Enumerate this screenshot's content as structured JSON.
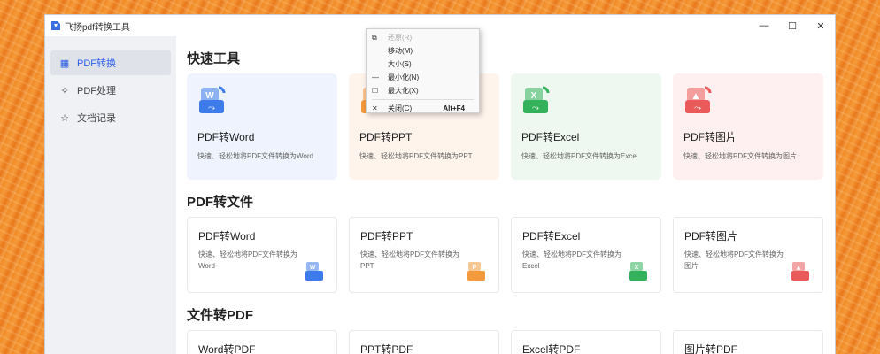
{
  "window": {
    "title": "飞扬pdf转换工具"
  },
  "titlebar": {
    "min_glyph": "—",
    "max_glyph": "☐",
    "close_glyph": "✕"
  },
  "sidebar": {
    "items": [
      {
        "label": "PDF转换",
        "icon": "grid-icon",
        "glyph": "▦",
        "active": true
      },
      {
        "label": "PDF处理",
        "icon": "magic-wand-icon",
        "glyph": "✧",
        "active": false
      },
      {
        "label": "文档记录",
        "icon": "star-icon",
        "glyph": "☆",
        "active": false
      }
    ]
  },
  "quick": {
    "title": "快速工具",
    "cards": [
      {
        "title": "PDF转Word",
        "desc": "快速、轻松地将PDF文件转换为Word",
        "letter": "W",
        "color": "#3d7bea"
      },
      {
        "title": "PDF转PPT",
        "desc": "快速、轻松地将PDF文件转换为PPT",
        "letter": "P",
        "color": "#f29a3c"
      },
      {
        "title": "PDF转Excel",
        "desc": "快速、轻松地将PDF文件转换为Excel",
        "letter": "X",
        "color": "#33b15b"
      },
      {
        "title": "PDF转图片",
        "desc": "快速、轻松地将PDF文件转换为图片",
        "letter": "▲",
        "color": "#ea5a5a"
      }
    ]
  },
  "pdf_to": {
    "title": "PDF转文件",
    "cards": [
      {
        "title": "PDF转Word",
        "desc": "快速、轻松地将PDF文件转换为Word",
        "letter": "W",
        "color": "#3d7bea"
      },
      {
        "title": "PDF转PPT",
        "desc": "快速、轻松地将PDF文件转换为PPT",
        "letter": "P",
        "color": "#f29a3c"
      },
      {
        "title": "PDF转Excel",
        "desc": "快速、轻松地将PDF文件转换为Excel",
        "letter": "X",
        "color": "#33b15b"
      },
      {
        "title": "PDF转图片",
        "desc": "快速、轻松地将PDF文件转换为图片",
        "letter": "▲",
        "color": "#ea5a5a"
      }
    ]
  },
  "to_pdf": {
    "title": "文件转PDF",
    "cards": [
      {
        "title": "Word转PDF"
      },
      {
        "title": "PPT转PDF"
      },
      {
        "title": "Excel转PDF"
      },
      {
        "title": "图片转PDF"
      }
    ]
  },
  "context_menu": {
    "items": [
      {
        "glyph": "⧉",
        "label": "还原(R)",
        "shortcut": "",
        "disabled": true
      },
      {
        "glyph": "",
        "label": "移动(M)",
        "shortcut": "",
        "disabled": false
      },
      {
        "glyph": "",
        "label": "大小(S)",
        "shortcut": "",
        "disabled": false
      },
      {
        "glyph": "—",
        "label": "最小化(N)",
        "shortcut": "",
        "disabled": false
      },
      {
        "glyph": "☐",
        "label": "最大化(X)",
        "shortcut": "",
        "disabled": false
      },
      {
        "glyph": "✕",
        "label": "关闭(C)",
        "shortcut": "Alt+F4",
        "disabled": false
      }
    ]
  }
}
